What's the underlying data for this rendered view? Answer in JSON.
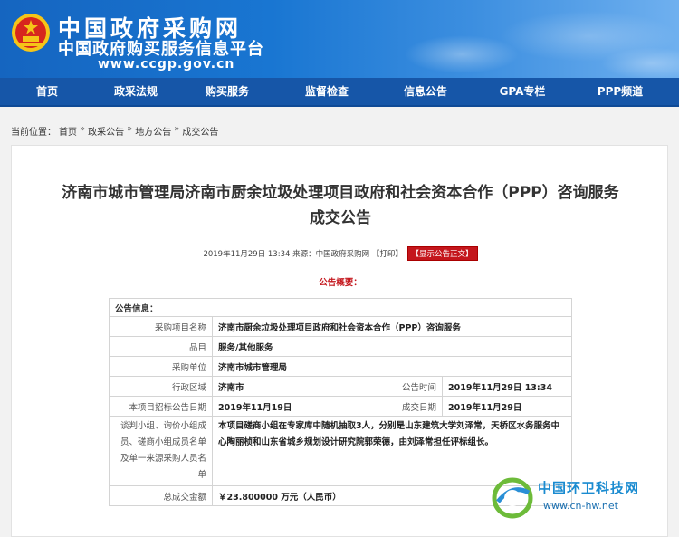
{
  "site": {
    "title": "中国政府采购网",
    "subtitle": "中国政府购买服务信息平台",
    "url": "www.ccgp.gov.cn",
    "brand_color": "#1656a8"
  },
  "nav": [
    "首页",
    "政采法规",
    "购买服务",
    "监督检查",
    "信息公告",
    "GPA专栏",
    "PPP频道"
  ],
  "breadcrumb": {
    "prefix": "当前位置：",
    "items": [
      "首页",
      "政采公告",
      "地方公告",
      "成交公告"
    ],
    "separator": "»"
  },
  "article": {
    "title_line1": "济南市城市管理局济南市厨余垃圾处理项目政府和社会资本合作（PPP）咨询服务",
    "title_line2": "成交公告",
    "meta": "2019年11月29日 13:34 来源：中国政府采购网",
    "print_label": "【打印】",
    "show_body_label": "【显示公告正文】",
    "summary_label": "公告概要："
  },
  "table": {
    "header": "公告信息：",
    "rows": {
      "project_name": {
        "label": "采购项目名称",
        "value": "济南市厨余垃圾处理项目政府和社会资本合作（PPP）咨询服务"
      },
      "category": {
        "label": "品目",
        "value": "服务/其他服务"
      },
      "buyer": {
        "label": "采购单位",
        "value": "济南市城市管理局"
      },
      "region": {
        "label": "行政区域",
        "value": "济南市"
      },
      "publish_time": {
        "label": "公告时间",
        "value": "2019年11月29日 13:34"
      },
      "bid_date": {
        "label": "本项目招标公告日期",
        "value": "2019年11月19日"
      },
      "deal_date": {
        "label": "成交日期",
        "value": "2019年11月29日"
      },
      "panel": {
        "label": "谈判小组、询价小组成员、磋商小组成员名单及单一来源采购人员名单",
        "value": "本项目磋商小组在专家库中随机抽取3人，分别是山东建筑大学刘泽常，天桥区水务服务中心陶丽桢和山东省城乡规划设计研究院郭荣德，由刘泽常担任评标组长。"
      },
      "amount": {
        "label": "总成交金额",
        "value": "￥23.800000 万元（人民币）"
      }
    }
  },
  "watermark": {
    "title": "中国环卫科技网",
    "url": "www.cn-hw.net"
  },
  "icons": [
    "national-emblem-icon",
    "watermark-globe-icon"
  ]
}
